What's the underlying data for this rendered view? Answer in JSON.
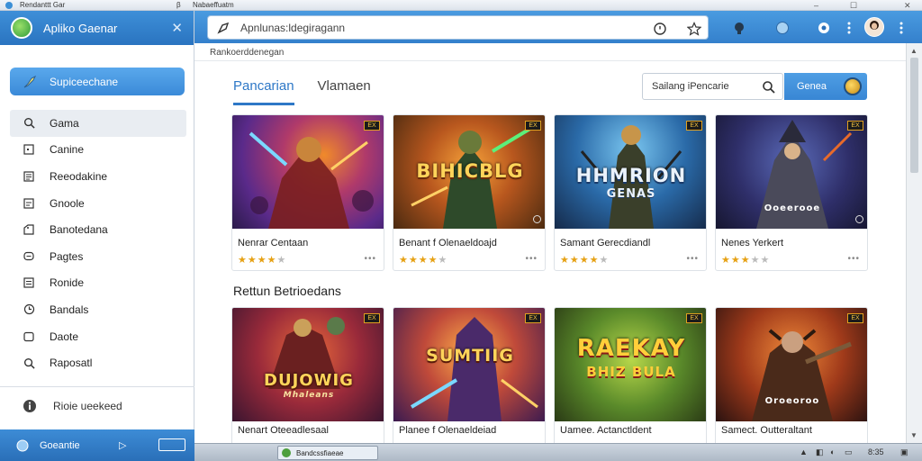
{
  "os_bar": {
    "title": "Rendanttt Gar",
    "icon_char": "β",
    "title2": "Nabaeffuatm",
    "window_controls": [
      "–",
      "☐",
      "✕"
    ]
  },
  "sidebar": {
    "app_title": "Apliko Gaenar",
    "close_glyph": "✕",
    "primary_button": "Supiceechane",
    "items": [
      {
        "label": "Gama",
        "icon": "search-icon"
      },
      {
        "label": "Canine",
        "icon": "square-icon"
      },
      {
        "label": "Reeodakine",
        "icon": "document-icon"
      },
      {
        "label": "Gnoole",
        "icon": "document-icon"
      },
      {
        "label": "Banotedana",
        "icon": "tag-icon"
      },
      {
        "label": "Pagtes",
        "icon": "chat-icon"
      },
      {
        "label": "Ronide",
        "icon": "list-icon"
      },
      {
        "label": "Bandals",
        "icon": "clock-icon"
      },
      {
        "label": "Daote",
        "icon": "chat-icon"
      },
      {
        "label": "Raposatl",
        "icon": "search-icon"
      }
    ],
    "footer_item": "Rioie ueekeed",
    "bottom_label": "Goeantie",
    "bottom_arrow": "▷"
  },
  "browser": {
    "address": "Apnlunas:ldegiragann"
  },
  "page": {
    "breadcrumb": "Rankoerddenegan",
    "tabs": [
      {
        "label": "Pancarian",
        "active": true
      },
      {
        "label": "Vlamaen",
        "active": false
      }
    ],
    "search_placeholder": "Sailang iPencarie",
    "search_button": "Genea",
    "row1": [
      {
        "title": "Nenrar Centaan",
        "rating": 3.5,
        "badge": "EX",
        "logo": ""
      },
      {
        "title": "Benant f Olenaeldoajd",
        "rating": 3.5,
        "badge": "EX",
        "logo": "BIHICBLG"
      },
      {
        "title": "Samant Gerecdiandl",
        "rating": 4,
        "badge": "EX",
        "logo": "HHMRION",
        "logo_sub": "GENAS"
      },
      {
        "title": "Nenes Yerkert",
        "rating": 3,
        "badge": "EX",
        "logo": "Ooeerooe"
      }
    ],
    "section_title": "Rettun Betrioedans",
    "row2": [
      {
        "title": "Nenart Oteeadlesaal",
        "badge": "EX",
        "logo": "DUJOWIG",
        "logo_sub": "Mhaleans"
      },
      {
        "title": "Planee f Olenaeldeiad",
        "badge": "EX",
        "logo": "SUMTIIG"
      },
      {
        "title": "Uamee. Actanctldent",
        "badge": "EX",
        "logo": "RAEKAY",
        "logo_sub": "BHIZ BULA"
      },
      {
        "title": "Samect. Outteraltant",
        "badge": "EX",
        "logo": "Oroeoroo"
      }
    ],
    "more_glyph": "•••"
  },
  "taskbar": {
    "item": "Bandcssfiaeae",
    "clock": "8:35"
  },
  "colors": {
    "accent": "#2e78c7",
    "star": "#e6a114",
    "toolbar": "#3b88d2"
  }
}
